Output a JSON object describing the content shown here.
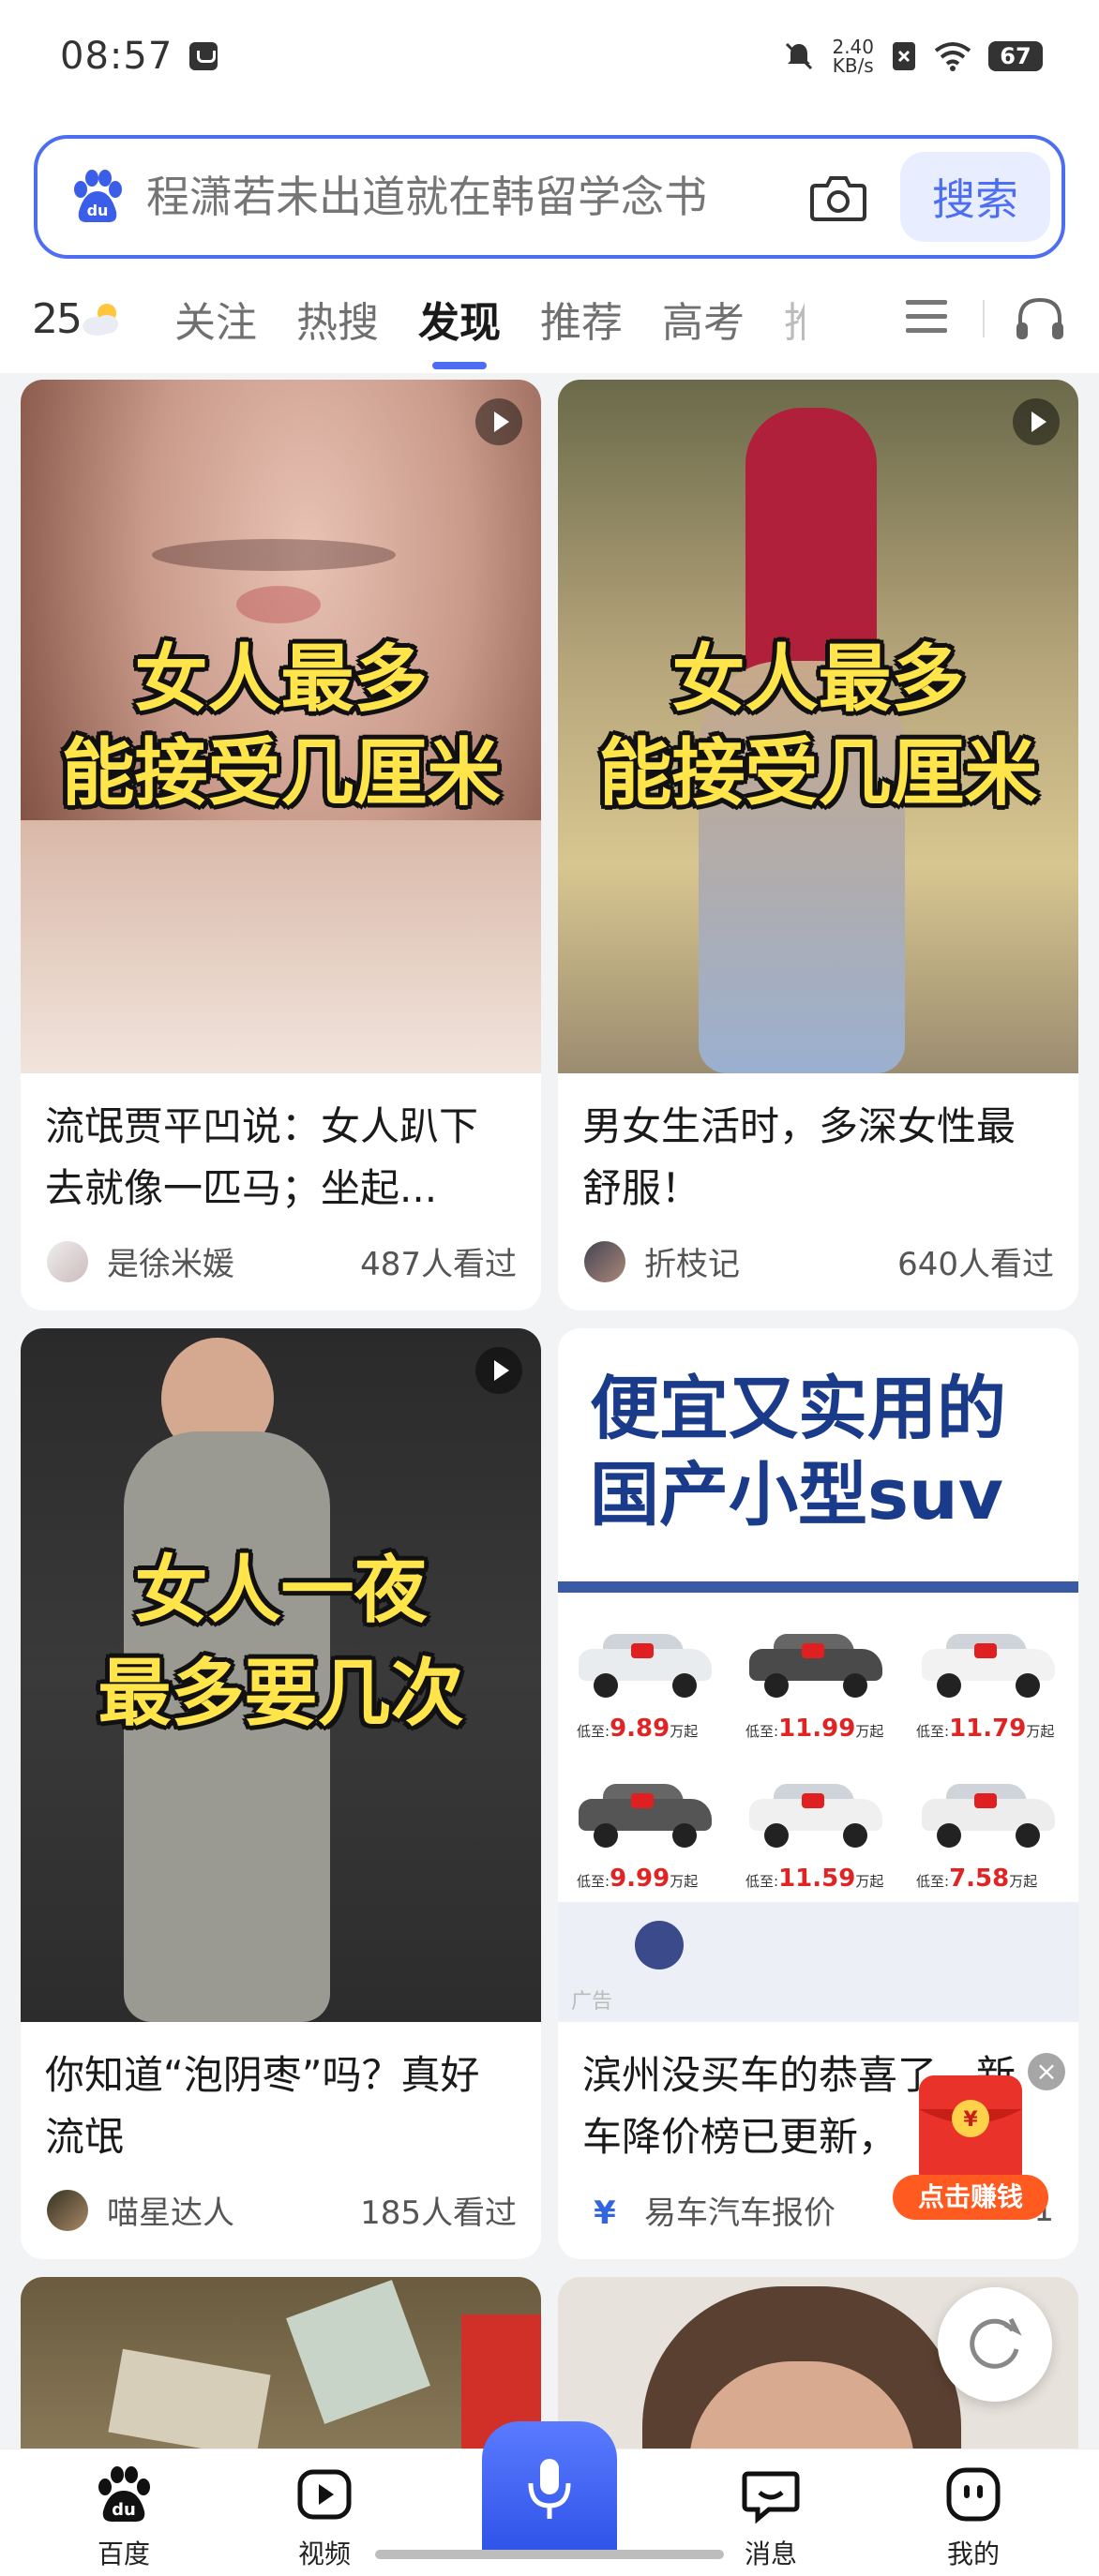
{
  "status_bar": {
    "time": "08:57",
    "net_speed_value": "2.40",
    "net_speed_unit": "KB/s",
    "battery": "67"
  },
  "search": {
    "placeholder": "程潇若未出道就在韩留学念书",
    "button_label": "搜索"
  },
  "weather": {
    "temp": "25"
  },
  "tabs": [
    {
      "label": "关注"
    },
    {
      "label": "热搜"
    },
    {
      "label": "发现",
      "active": true
    },
    {
      "label": "推荐"
    },
    {
      "label": "高考"
    },
    {
      "label": "推"
    }
  ],
  "feed": [
    {
      "overlay_line1": "女人最多",
      "overlay_line2": "能接受几厘米",
      "title": "流氓贾平凹说：女人趴下去就像一匹马；坐起...",
      "author": "是徐米媛",
      "views": "487人看过",
      "is_video": true
    },
    {
      "overlay_line1": "女人最多",
      "overlay_line2": "能接受几厘米",
      "title": "男女生活时，多深女性最舒服！",
      "author": "折枝记",
      "views": "640人看过",
      "is_video": true
    },
    {
      "overlay_line1": "女人一夜",
      "overlay_line2": "最多要几次",
      "title": "你知道“泡阴枣”吗？真好流氓",
      "author": "喵星达人",
      "views": "185人看过",
      "is_video": true
    },
    {
      "ad_headline_line1": "便宜又实用的",
      "ad_headline_line2": "国产小型suv",
      "title": "滨州没买车的恭喜了，新车降价榜已更新，",
      "author": "易车汽车报价",
      "views": "1",
      "ad_tag": "广告",
      "prices": [
        {
          "prefix": "低至:",
          "value": "9.89",
          "suffix": "万起"
        },
        {
          "prefix": "低至:",
          "value": "11.99",
          "suffix": "万起"
        },
        {
          "prefix": "低至:",
          "value": "11.79",
          "suffix": "万起"
        },
        {
          "prefix": "低至:",
          "value": "9.99",
          "suffix": "万起"
        },
        {
          "prefix": "低至:",
          "value": "11.59",
          "suffix": "万起"
        },
        {
          "prefix": "低至:",
          "value": "7.58",
          "suffix": "万起"
        }
      ]
    }
  ],
  "floating": {
    "red_packet_label": "点击赚钱",
    "red_packet_symbol": "¥",
    "close": "×"
  },
  "bottom_nav": [
    {
      "label": "百度"
    },
    {
      "label": "视频"
    },
    {
      "label": ""
    },
    {
      "label": "消息"
    },
    {
      "label": "我的"
    }
  ],
  "colors": {
    "accent": "#4e6ef2",
    "overlay_text": "#ffe54a",
    "ad_headline": "#1a3a8a",
    "price_red": "#e02424"
  }
}
